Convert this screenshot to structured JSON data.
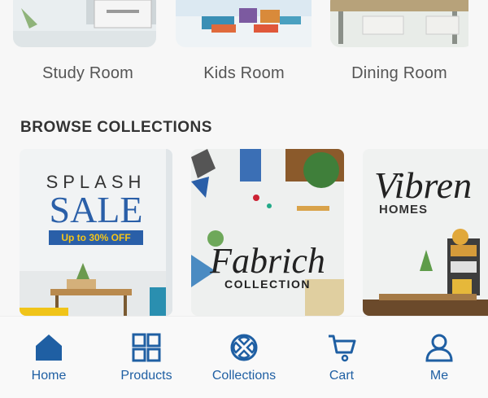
{
  "rooms": [
    {
      "label": "Study Room"
    },
    {
      "label": "Kids Room"
    },
    {
      "label": "Dining Room"
    }
  ],
  "section_title": "BROWSE COLLECTIONS",
  "collections": [
    {
      "line1": "SPLASH",
      "line2": "SALE",
      "badge": "Up to 30% OFF"
    },
    {
      "script": "Fabrich",
      "sub": "COLLECTION"
    },
    {
      "script": "Vibren",
      "sub": "HOMES"
    }
  ],
  "tabs": [
    {
      "label": "Home",
      "icon": "home-icon"
    },
    {
      "label": "Products",
      "icon": "grid-icon"
    },
    {
      "label": "Collections",
      "icon": "collections-icon"
    },
    {
      "label": "Cart",
      "icon": "cart-icon"
    },
    {
      "label": "Me",
      "icon": "user-icon"
    }
  ],
  "colors": {
    "accent": "#1f5fa3",
    "badge_bg": "#2a5fa8",
    "badge_text": "#f5c518"
  }
}
